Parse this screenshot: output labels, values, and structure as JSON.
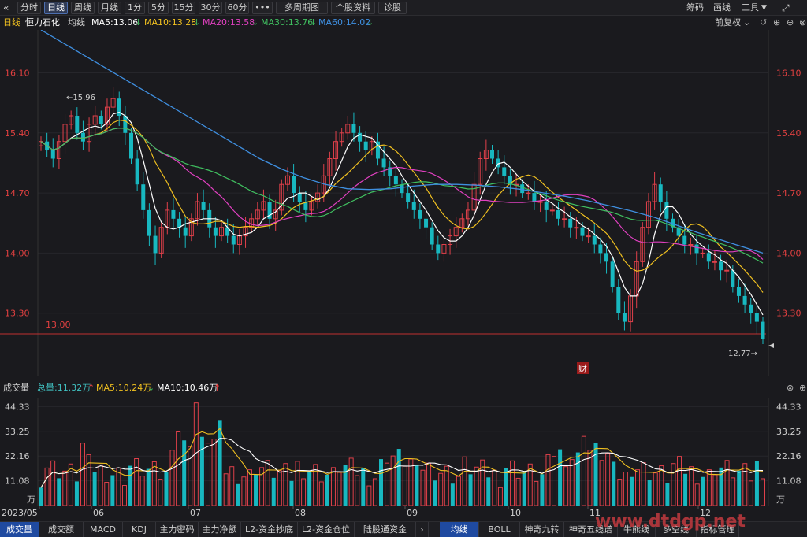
{
  "toolbar": {
    "back_icon": "double-left-arrow",
    "tabs": [
      "分时",
      "日线",
      "周线",
      "月线",
      "1分",
      "5分",
      "15分",
      "30分",
      "60分",
      "•••",
      "多周期图",
      "个股资料",
      "诊股"
    ],
    "active_tab": "日线",
    "right": [
      "筹码",
      "画线",
      "工具"
    ],
    "tools_dropdown_icon": "chevron-down",
    "fullscreen_icon": "expand-arrows"
  },
  "ma_bar": {
    "period": "日线",
    "stock_name": "恒力石化",
    "avg_label": "均线",
    "ma5": "MA5:13.06",
    "ma10": "MA10:13.28",
    "ma20": "MA20:13.58",
    "ma30": "MA30:13.76",
    "ma60": "MA60:14.02",
    "adj": "前复权",
    "arrow_down": "↓",
    "colors": {
      "ma5": "#ffffff",
      "ma10": "#f0c020",
      "ma20": "#e040c0",
      "ma30": "#40c060",
      "ma60": "#3f8fe0",
      "down": "#40c060",
      "up": "#f04040"
    }
  },
  "price_axis": {
    "labels": [
      "16.10",
      "15.40",
      "14.70",
      "14.00",
      "13.30"
    ],
    "ref_line": "13.00",
    "high_marker": "15.96",
    "low_marker": "12.77",
    "cai_badge": "财"
  },
  "volume_bar": {
    "title": "成交量",
    "total": "总量:11.32万",
    "ma5": "MA5:10.24万",
    "ma10": "MA10:10.46万",
    "up_arrow": "↑",
    "down_arrow": "↓",
    "labels": [
      "44.33",
      "33.25",
      "22.16",
      "11.08"
    ],
    "unit": "万"
  },
  "date_axis": [
    "2023/05",
    "06",
    "07",
    "08",
    "09",
    "10",
    "11",
    "12"
  ],
  "bottom_tabs_left": [
    "成交量",
    "成交额",
    "MACD",
    "KDJ",
    "主力密码",
    "主力净额",
    "L2-资金抄底",
    "L2-资金仓位",
    "陆股通资金"
  ],
  "bottom_tabs_right": [
    "均线",
    "BOLL",
    "神奇九转",
    "神奇五线谱",
    "牛熊线",
    "多空线",
    "指标管理"
  ],
  "active_bottom_left": "成交量",
  "active_bottom_right": "均线",
  "watermark": "www.dtdgp.net",
  "chart_data": {
    "type": "candlestick",
    "ylim": [
      12.6,
      16.6
    ],
    "y_ticks": [
      16.1,
      15.4,
      14.7,
      14.0,
      13.3
    ],
    "ma60_path": [
      16.6,
      16.45,
      16.3,
      16.15,
      16.0,
      15.85,
      15.7,
      15.55,
      15.4,
      15.25,
      15.1,
      14.98,
      14.88,
      14.8,
      14.75,
      14.74,
      14.75,
      14.78,
      14.8,
      14.8,
      14.79,
      14.77,
      14.74,
      14.7,
      14.66,
      14.61,
      14.55,
      14.49,
      14.42,
      14.33,
      14.24,
      14.16,
      14.08,
      14.0
    ],
    "volume_ylim": [
      0,
      48
    ]
  }
}
